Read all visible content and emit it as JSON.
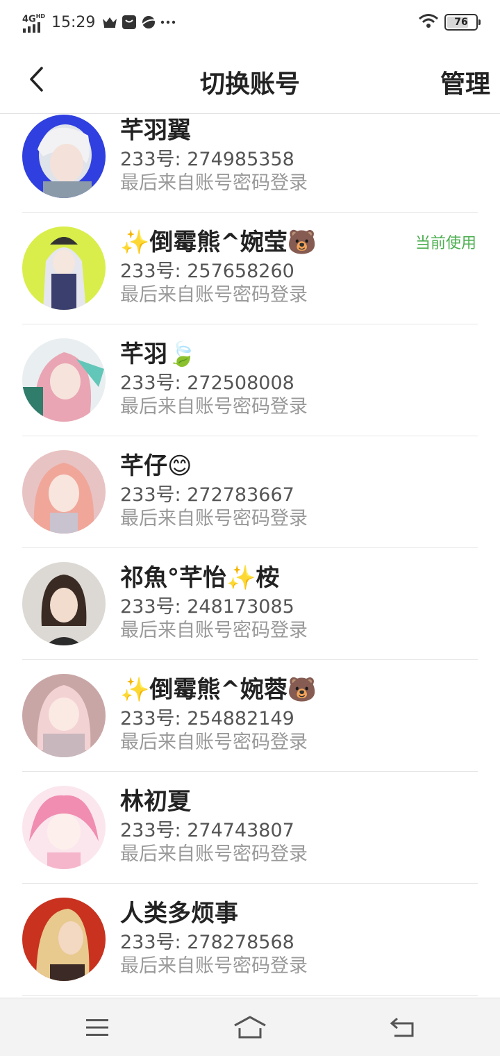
{
  "status_bar": {
    "network": "4G",
    "network_sup": "HD",
    "time": "15:29",
    "battery": "76",
    "battery_level": 0.76,
    "icons": [
      "crown-icon",
      "message-icon",
      "planet-icon",
      "more-icon",
      "wifi-icon",
      "battery-icon"
    ]
  },
  "header": {
    "title": "切换账号",
    "manage_label": "管理",
    "back_icon": "chevron-left-icon"
  },
  "accounts": [
    {
      "name": "芊羽翼",
      "uid": "233号: 274985358",
      "source": "最后来自账号密码登录",
      "current": ""
    },
    {
      "name": "✨倒霉熊^婉莹🐻",
      "uid": "233号: 257658260",
      "source": "最后来自账号密码登录",
      "current": "当前使用"
    },
    {
      "name": "芊羽🍃",
      "uid": "233号: 272508008",
      "source": "最后来自账号密码登录",
      "current": ""
    },
    {
      "name": "芊仔😊",
      "uid": "233号: 272783667",
      "source": "最后来自账号密码登录",
      "current": ""
    },
    {
      "name": "祁魚°芊怡✨桉",
      "uid": "233号: 248173085",
      "source": "最后来自账号密码登录",
      "current": ""
    },
    {
      "name": "✨倒霉熊^婉蓉🐻",
      "uid": "233号: 254882149",
      "source": "最后来自账号密码登录",
      "current": ""
    },
    {
      "name": "林初夏",
      "uid": "233号: 274743807",
      "source": "最后来自账号密码登录",
      "current": ""
    },
    {
      "name": "人类多烦事",
      "uid": "233号: 278278568",
      "source": "最后来自账号密码登录",
      "current": ""
    }
  ],
  "navbar": {
    "icons": [
      "menu-icon",
      "home-icon",
      "back-arrow-icon"
    ]
  },
  "colors": {
    "accent_green": "#4caf50",
    "divider": "#e6e6e6",
    "nav_bg": "#f3f3f3"
  }
}
